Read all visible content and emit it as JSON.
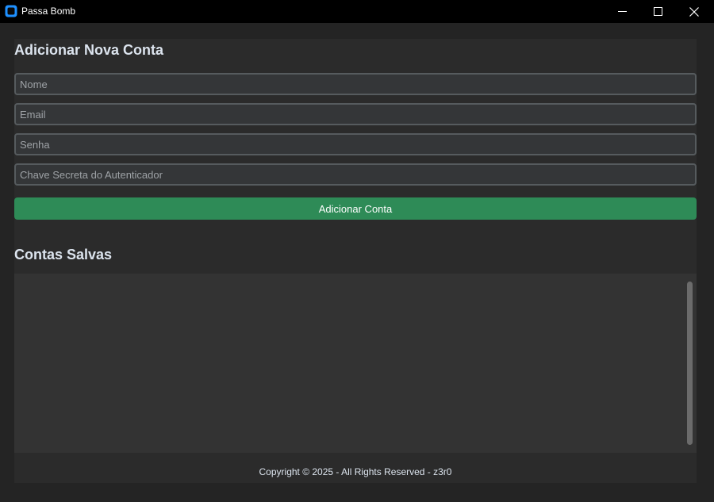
{
  "window": {
    "title": "Passa Bomb",
    "app_icon": "app-logo-icon",
    "controls": {
      "minimize_icon": "minimize-icon",
      "maximize_icon": "maximize-icon",
      "close_icon": "close-icon"
    }
  },
  "add_account": {
    "heading": "Adicionar Nova Conta",
    "fields": {
      "name": {
        "placeholder": "Nome",
        "value": ""
      },
      "email": {
        "placeholder": "Email",
        "value": ""
      },
      "password": {
        "placeholder": "Senha",
        "value": ""
      },
      "secret_key": {
        "placeholder": "Chave Secreta do Autenticador",
        "value": ""
      }
    },
    "submit_label": "Adicionar Conta"
  },
  "saved_accounts": {
    "heading": "Contas Salvas",
    "items": []
  },
  "footer": {
    "copyright": "Copyright © 2025 - All Rights Reserved - z3r0"
  },
  "colors": {
    "accent": "#2e8b57",
    "app_icon": "#1e90ff",
    "background": "#242424",
    "panel": "#2b2b2b",
    "titlebar": "#000000"
  }
}
